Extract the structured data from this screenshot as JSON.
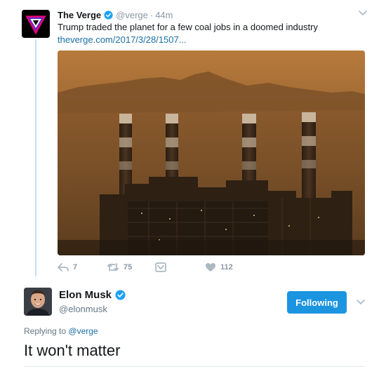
{
  "parent_tweet": {
    "display_name": "The Verge",
    "handle": "@verge",
    "separator": "·",
    "time": "44m",
    "text": "Trump traded the planet for a few coal jobs in a doomed industry",
    "link": "theverge.com/2017/3/28/1507...",
    "image_icon": "power-plant-smokestacks-photo",
    "actions": {
      "reply_count": "7",
      "retweet_count": "75",
      "like_count": "112"
    }
  },
  "reply_tweet": {
    "display_name": "Elon Musk",
    "handle": "@elonmusk",
    "follow_label": "Following",
    "replying_prefix": "Replying to",
    "replying_to": "@verge",
    "text": "It won't matter"
  },
  "colors": {
    "brand_blue": "#1b95e0",
    "link": "#1b6fa5",
    "muted": "#8b98a5",
    "thread_line": "#c4e0f2"
  }
}
